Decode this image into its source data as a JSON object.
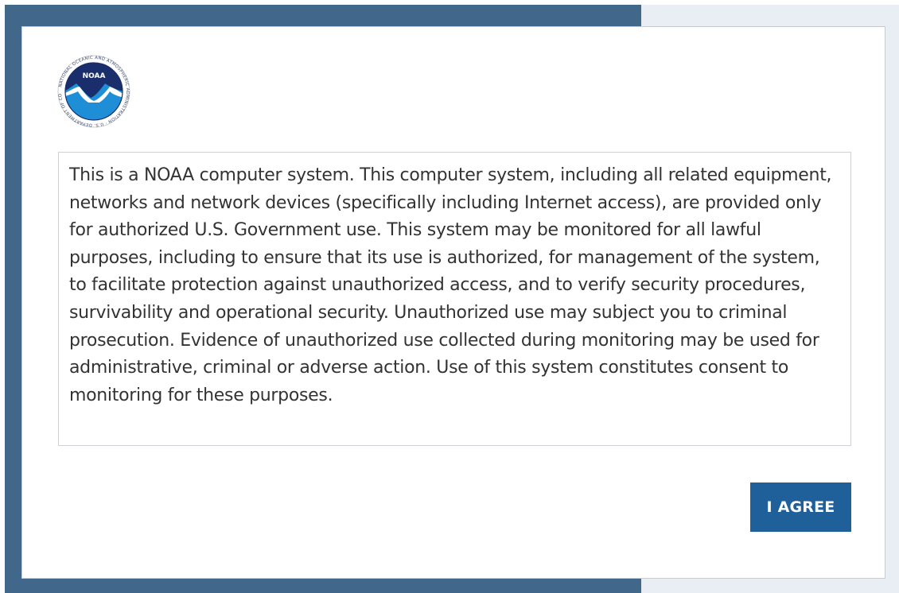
{
  "dialog": {
    "logo": {
      "icon": "noaa-logo-icon",
      "emblem_text": "NOAA",
      "ring_text": "NATIONAL OCEANIC AND ATMOSPHERIC ADMINISTRATION · U.S. DEPARTMENT OF COMMERCE"
    },
    "notice_text": "This is a NOAA computer system. This computer system, including all related equipment, networks and network devices (specifically including Internet access), are provided only for authorized U.S. Government use. This system may be monitored for all lawful purposes, including to ensure that its use is authorized, for management of the system, to facilitate protection against unauthorized access, and to verify security procedures, survivability and operational security. Unauthorized use may subject you to criminal prosecution. Evidence of unauthorized use collected during monitoring may be used for administrative, criminal or adverse action. Use of this system constitutes consent to monitoring for these purposes.",
    "agree_label": "I AGREE"
  },
  "colors": {
    "backdrop_left": "#41688a",
    "backdrop_right": "#e9eef5",
    "button": "#1f5f9a",
    "noaa_dark_blue": "#1a2e6b",
    "noaa_light_blue": "#1e8fd6"
  }
}
